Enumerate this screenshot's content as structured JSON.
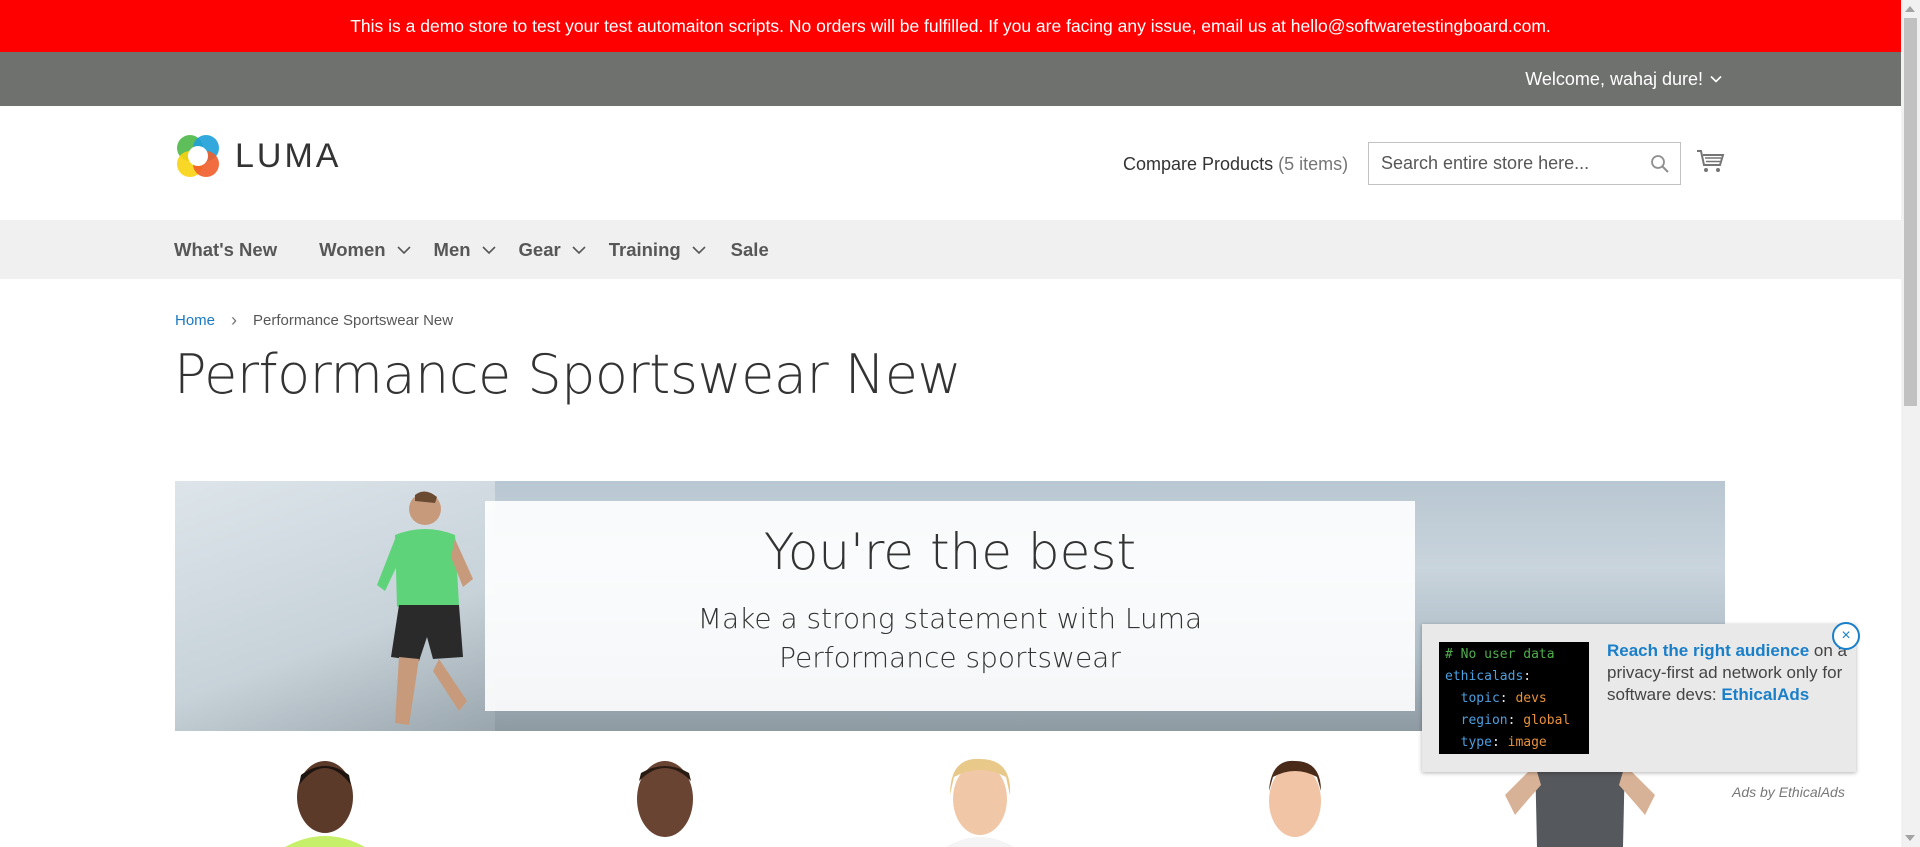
{
  "demo_notice": "This is a demo store to test your test automaiton scripts. No orders will be fulfilled. If you are facing any issue, email us at hello@softwaretestingboard.com.",
  "panel": {
    "welcome": "Welcome, wahaj dure!"
  },
  "header": {
    "logo_text": "LUMA",
    "compare_label": "Compare Products",
    "compare_count": "(5 items)",
    "search_placeholder": "Search entire store here..."
  },
  "nav": {
    "items": [
      {
        "label": "What's New",
        "has_dropdown": false
      },
      {
        "label": "Women",
        "has_dropdown": true
      },
      {
        "label": "Men",
        "has_dropdown": true
      },
      {
        "label": "Gear",
        "has_dropdown": true
      },
      {
        "label": "Training",
        "has_dropdown": true
      },
      {
        "label": "Sale",
        "has_dropdown": false
      }
    ]
  },
  "breadcrumb": {
    "home": "Home",
    "separator": "›",
    "current": "Performance Sportswear New"
  },
  "page_title": "Performance Sportswear New",
  "banner": {
    "title": "You're the best",
    "subtitle": "Make a strong statement with Luma Performance sportswear"
  },
  "ad": {
    "code_lines": [
      {
        "comment": "# No user data"
      },
      {
        "key": "ethicalads",
        "value": ""
      },
      {
        "key": "topic",
        "value": "devs"
      },
      {
        "key": "region",
        "value": "global"
      },
      {
        "key": "type",
        "value": "image"
      }
    ],
    "headline": "Reach the right audience",
    "body_after": " on a privacy-first ad network only for software devs: ",
    "brand": "EthicalAds",
    "close": "×",
    "credit": "Ads by EthicalAds"
  },
  "colors": {
    "notice_bg": "#ff0000",
    "panel_bg": "#6e716e",
    "nav_bg": "#f0f0f0",
    "link": "#1979c3",
    "ad_link": "#1a7fc9"
  }
}
